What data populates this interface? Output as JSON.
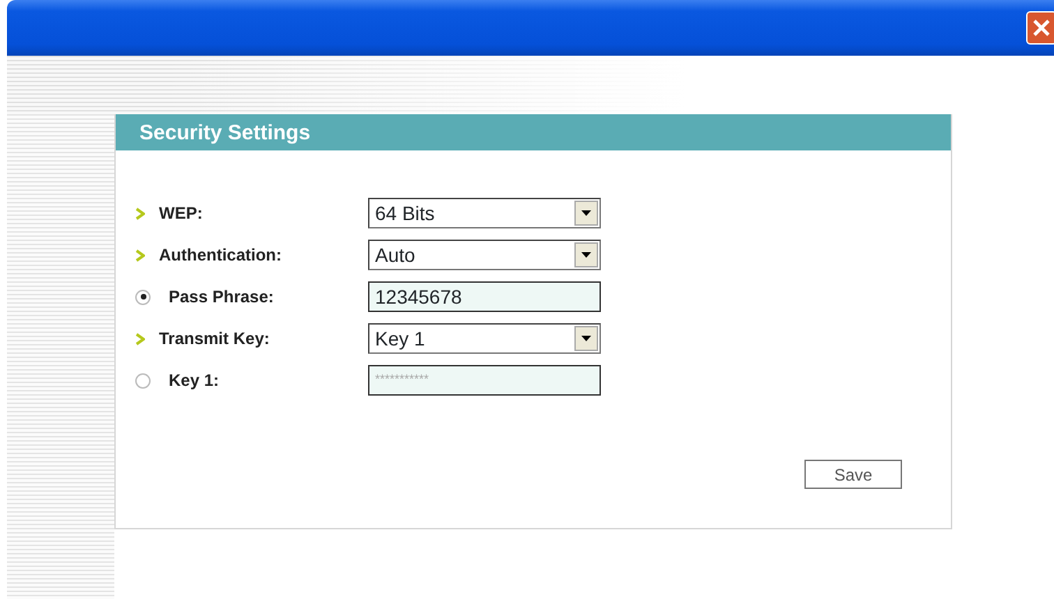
{
  "panel": {
    "title": "Security Settings"
  },
  "fields": [
    {
      "label": "WEP:",
      "kind": "select",
      "value": "64 Bits"
    },
    {
      "label": "Authentication:",
      "kind": "select",
      "value": "Auto",
      "children": [
        {
          "label": "Pass Phrase:",
          "selected": true,
          "kind": "text",
          "value": "12345678"
        },
        {
          "label": "Transmit Key:",
          "kind": "select",
          "value": "Key 1"
        },
        {
          "label": "Key 1:",
          "selected": false,
          "kind": "masked",
          "value": "***********"
        }
      ]
    }
  ],
  "buttons": [
    {
      "label": "Save"
    }
  ]
}
